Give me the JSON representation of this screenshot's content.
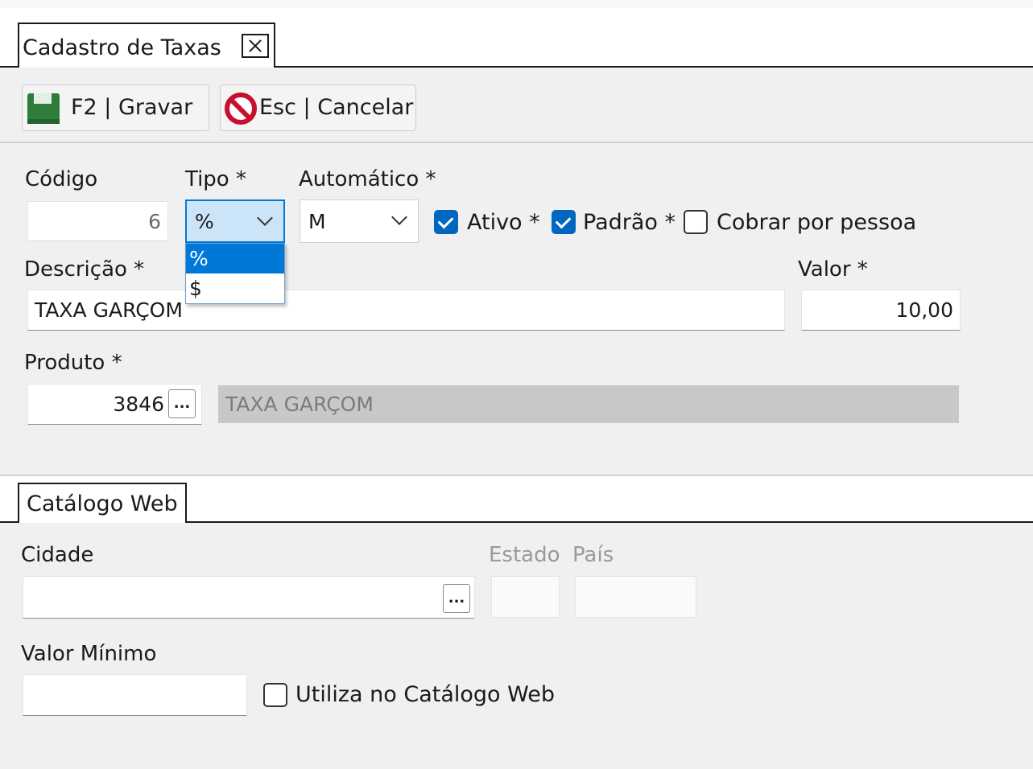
{
  "tab": {
    "title": "Cadastro de Taxas"
  },
  "toolbar": {
    "save_label": "F2 | Gravar",
    "cancel_label": "Esc | Cancelar"
  },
  "form": {
    "codigo": {
      "label": "Código",
      "value": "6"
    },
    "tipo": {
      "label": "Tipo *",
      "value": "%",
      "options": [
        "%",
        "$"
      ],
      "selected_index": 0
    },
    "automatico": {
      "label": "Automático *",
      "value": "M"
    },
    "ativo": {
      "label": "Ativo *",
      "checked": true
    },
    "padrao": {
      "label": "Padrão *",
      "checked": true
    },
    "cobrar_por_pessoa": {
      "label": "Cobrar por pessoa",
      "checked": false
    },
    "descricao": {
      "label": "Descrição *",
      "value": "TAXA GARÇOM"
    },
    "valor": {
      "label": "Valor *",
      "value": "10,00"
    },
    "produto": {
      "label": "Produto *",
      "code": "3846",
      "button_label": "...",
      "description": "TAXA GARÇOM"
    }
  },
  "web_tab": {
    "title": "Catálogo Web",
    "cidade": {
      "label": "Cidade",
      "value": "",
      "button_label": "..."
    },
    "estado": {
      "label": "Estado",
      "value": ""
    },
    "pais": {
      "label": "País",
      "value": ""
    },
    "valor_minimo": {
      "label": "Valor Mínimo",
      "value": ""
    },
    "utiliza": {
      "label": "Utiliza no Catálogo Web",
      "checked": false
    }
  },
  "colors": {
    "accent": "#0078d7",
    "checkbox_on": "#0067c0",
    "save_icon": "#2f7d3b",
    "cancel_icon": "#c8102e"
  }
}
